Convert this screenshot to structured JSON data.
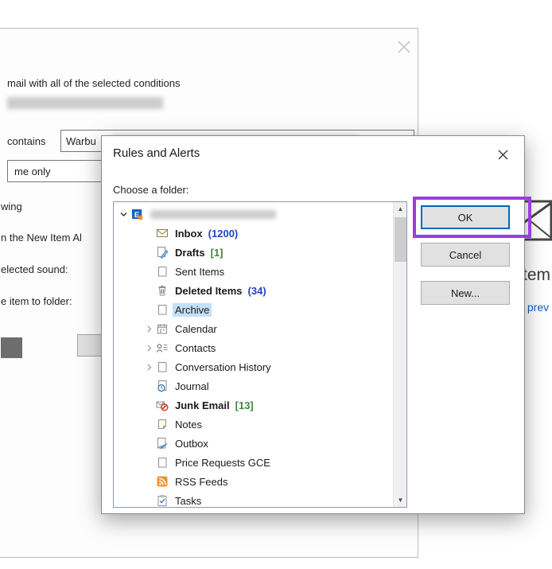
{
  "background_window": {
    "condition_text": "mail with all of the selected conditions",
    "contains_label": "contains",
    "value_input": {
      "value": "Warbu"
    },
    "me_only_dropdown": {
      "value": "me only"
    },
    "fragments": {
      "f1": "wing",
      "f2": "n the New Item Al",
      "f3": "elected sound:",
      "f4": "e item to folder:"
    },
    "right_fragments": {
      "item_text": "tem",
      "preview_text": "s prev"
    }
  },
  "dialog": {
    "title": "Rules and Alerts",
    "prompt": "Choose a folder:",
    "buttons": {
      "ok": "OK",
      "cancel": "Cancel",
      "new": "New..."
    },
    "tree": {
      "items": [
        {
          "label": "",
          "blurred": true,
          "icon": "exchange-account-icon",
          "level": 0,
          "expander": "expanded"
        },
        {
          "label": "Inbox",
          "suffix": "(1200)",
          "suffix_style": "unread",
          "bold": true,
          "icon": "inbox-icon",
          "level": 1
        },
        {
          "label": "Drafts",
          "suffix": "[1]",
          "suffix_style": "total",
          "bold": true,
          "icon": "drafts-icon",
          "level": 1
        },
        {
          "label": "Sent Items",
          "icon": "folder-icon",
          "level": 1
        },
        {
          "label": "Deleted Items",
          "suffix": "(34)",
          "suffix_style": "unread",
          "bold": true,
          "icon": "deleted-items-icon",
          "level": 1
        },
        {
          "label": "Archive",
          "icon": "folder-icon",
          "level": 1,
          "selected": true
        },
        {
          "label": "Calendar",
          "icon": "calendar-icon",
          "level": 1,
          "expander": "collapsed"
        },
        {
          "label": "Contacts",
          "icon": "contacts-icon",
          "level": 1,
          "expander": "collapsed"
        },
        {
          "label": "Conversation History",
          "icon": "folder-icon",
          "level": 1,
          "expander": "collapsed"
        },
        {
          "label": "Journal",
          "icon": "journal-icon",
          "level": 1
        },
        {
          "label": "Junk Email",
          "suffix": "[13]",
          "suffix_style": "total",
          "bold": true,
          "icon": "junk-email-icon",
          "level": 1
        },
        {
          "label": "Notes",
          "icon": "notes-icon",
          "level": 1
        },
        {
          "label": "Outbox",
          "icon": "outbox-icon",
          "level": 1
        },
        {
          "label": "Price Requests GCE",
          "icon": "folder-icon",
          "level": 1
        },
        {
          "label": "RSS Feeds",
          "icon": "rss-icon",
          "level": 1
        },
        {
          "label": "Tasks",
          "icon": "tasks-icon",
          "level": 1
        }
      ]
    }
  },
  "colors": {
    "unread_count_blue": "#2144c0",
    "total_count_green": "#3a8a3a",
    "selection_highlight": "#c2e0f7",
    "annotation_purple": "#9d3be0",
    "ok_focus_border": "#0067c0"
  }
}
